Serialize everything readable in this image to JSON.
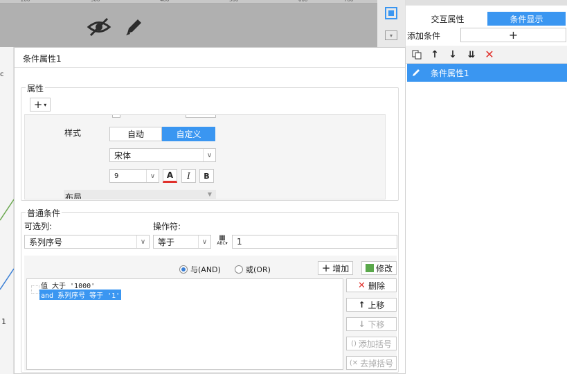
{
  "ruler": {
    "ticks": [
      "200",
      "300",
      "400",
      "500",
      "600",
      "700"
    ]
  },
  "canvas": {
    "hide_icon": "eye-slash-icon",
    "edit_icon": "pencil-icon"
  },
  "right_panel": {
    "tabs": [
      "交互属性",
      "条件显示"
    ],
    "add_condition_label": "添加条件",
    "add_symbol": "+",
    "selected_item": "条件属性1"
  },
  "dialog": {
    "title": "条件属性1",
    "property_group": {
      "label": "属性",
      "add_symbol": "+",
      "style_label": "样式",
      "style_toggle": [
        "自动",
        "自定义"
      ],
      "font_name": "宋体",
      "font_size": "9",
      "text_color_glyph": "A",
      "italic_glyph": "I",
      "bold_glyph": "B",
      "layout_label": "布局"
    },
    "condition_group": {
      "label": "普通条件",
      "column_label": "可选列:",
      "operator_label": "操作符:",
      "column_value": "系列序号",
      "operator_value": "等于",
      "value": "1",
      "and_label": "与(AND)",
      "or_label": "或(OR)",
      "add_button": "增加",
      "modify_button": "修改",
      "conditions": [
        "值 大于 '1000'",
        "and 系列序号 等于 '1'"
      ],
      "delete_button": "删除",
      "up_button": "上移",
      "down_button": "下移",
      "add_bracket_button": "添加括号",
      "remove_bracket_button": "去掉括号"
    }
  },
  "left_strip": {
    "marker_top": "c",
    "marker_bottom": "1"
  }
}
